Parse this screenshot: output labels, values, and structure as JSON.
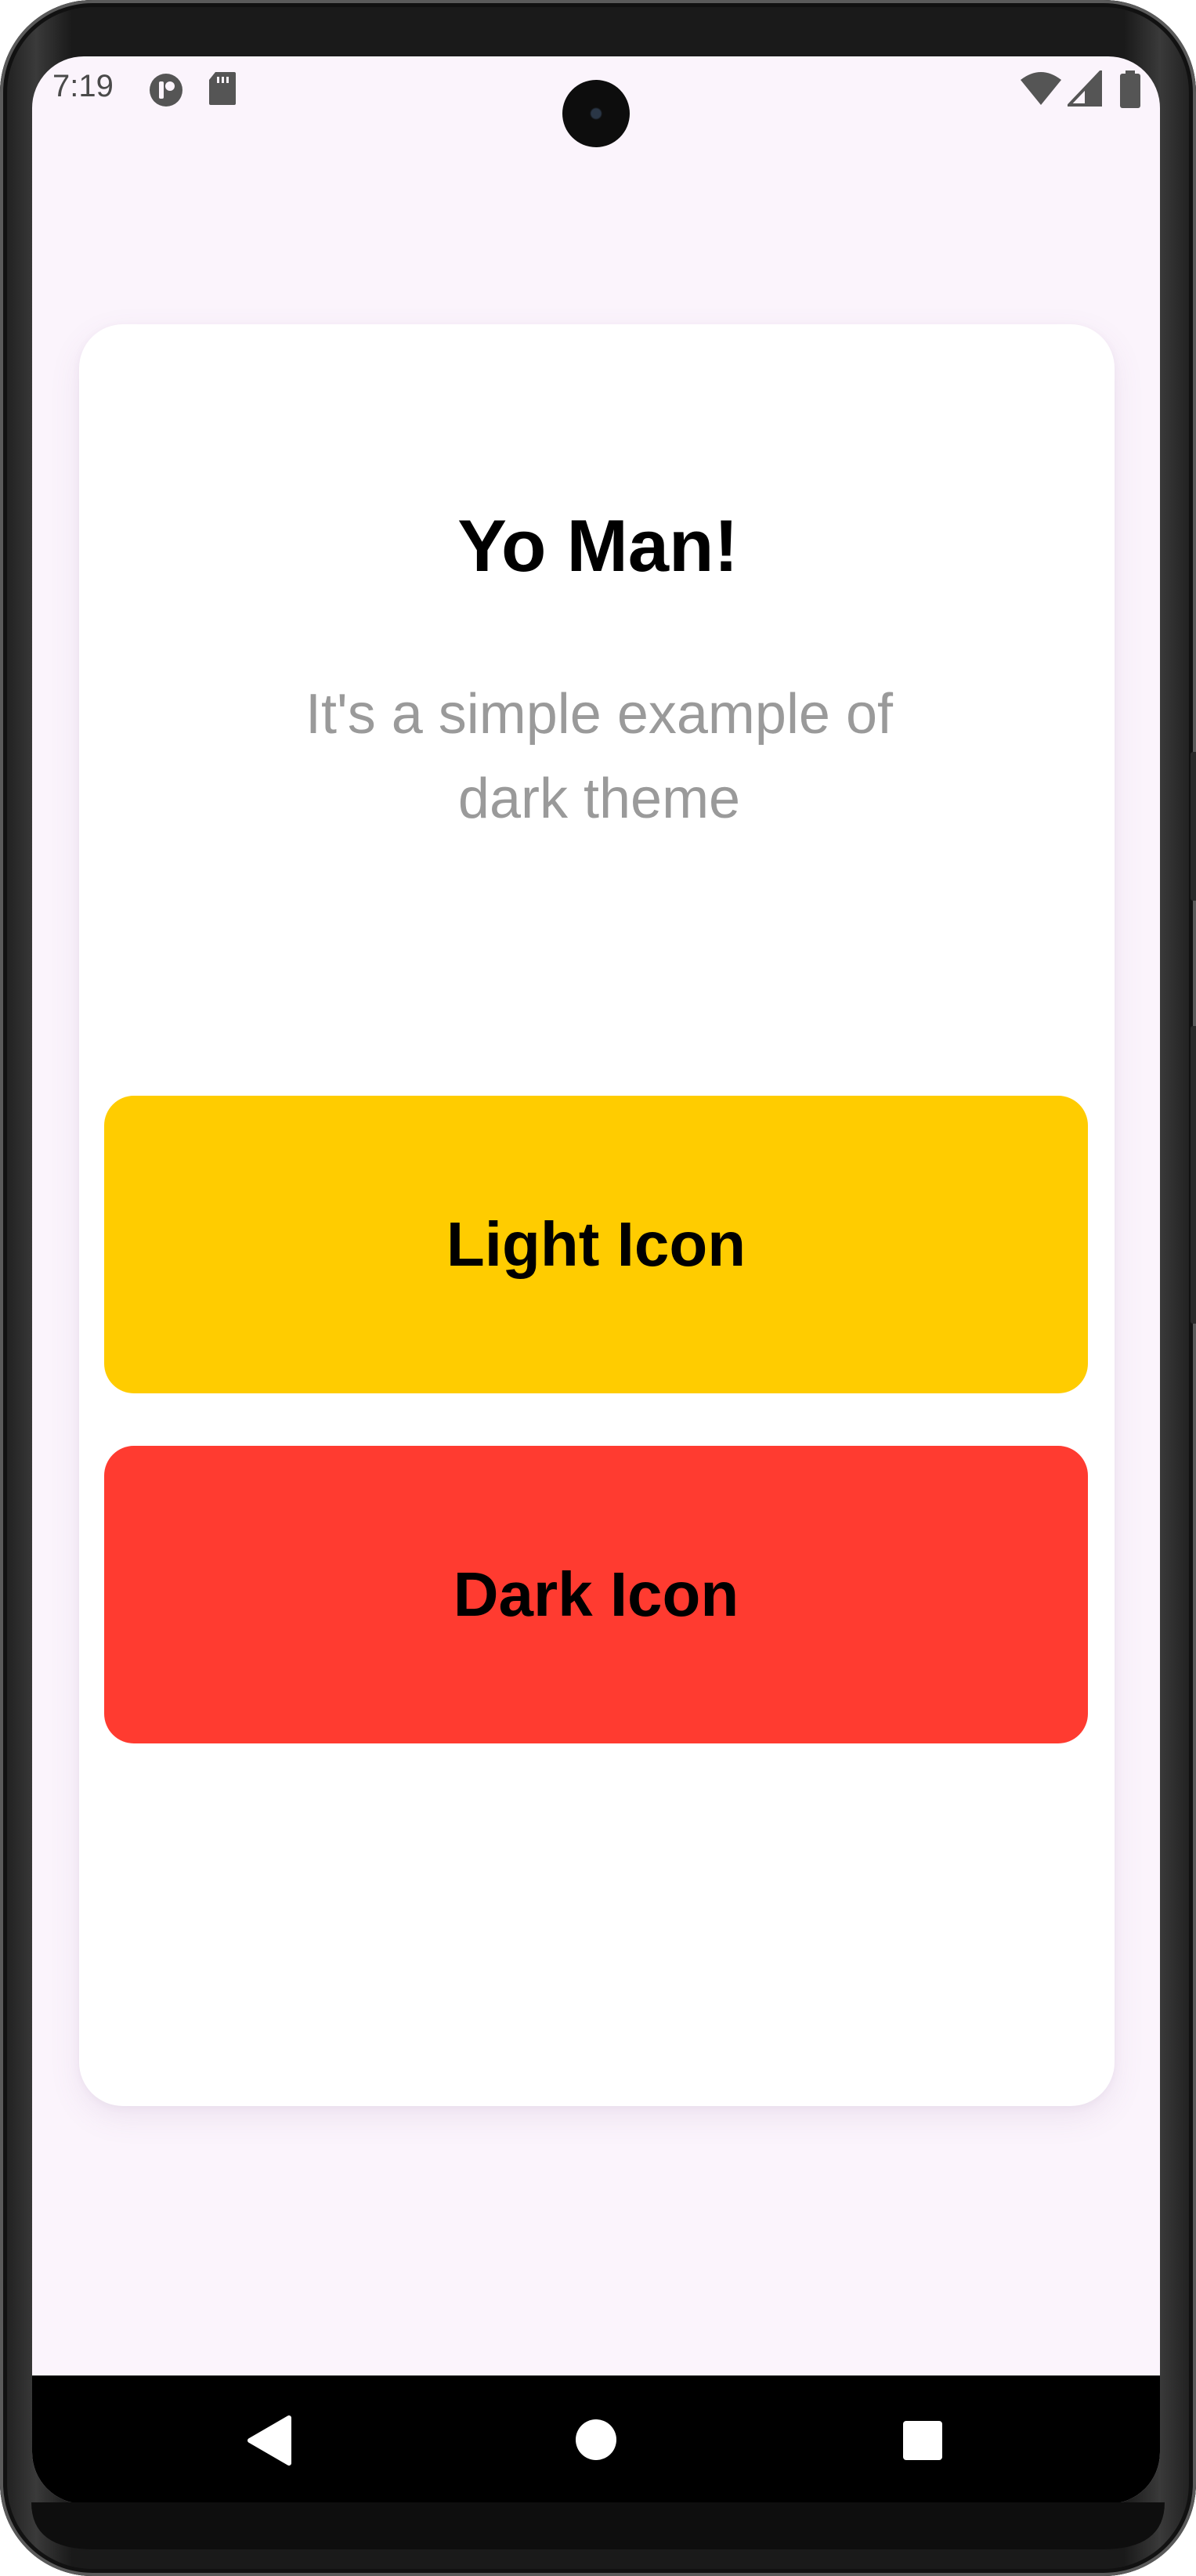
{
  "status_bar": {
    "time": "7:19",
    "left_icons": [
      "cast-icon",
      "sd-card-icon"
    ],
    "right_icons": [
      "wifi-icon",
      "cellular-signal-icon",
      "battery-icon"
    ]
  },
  "card": {
    "title": "Yo Man!",
    "subtitle": "It's a simple example of dark theme"
  },
  "buttons": {
    "light_label": "Light Icon",
    "dark_label": "Dark Icon"
  },
  "colors": {
    "screen_background": "#fbf4fc",
    "card_background": "#ffffff",
    "light_button": "#ffcc00",
    "dark_button": "#ff3b30",
    "subtitle_text": "#9a9a9a"
  },
  "nav_bar": {
    "buttons": [
      "back-icon",
      "home-icon",
      "recents-icon"
    ]
  }
}
